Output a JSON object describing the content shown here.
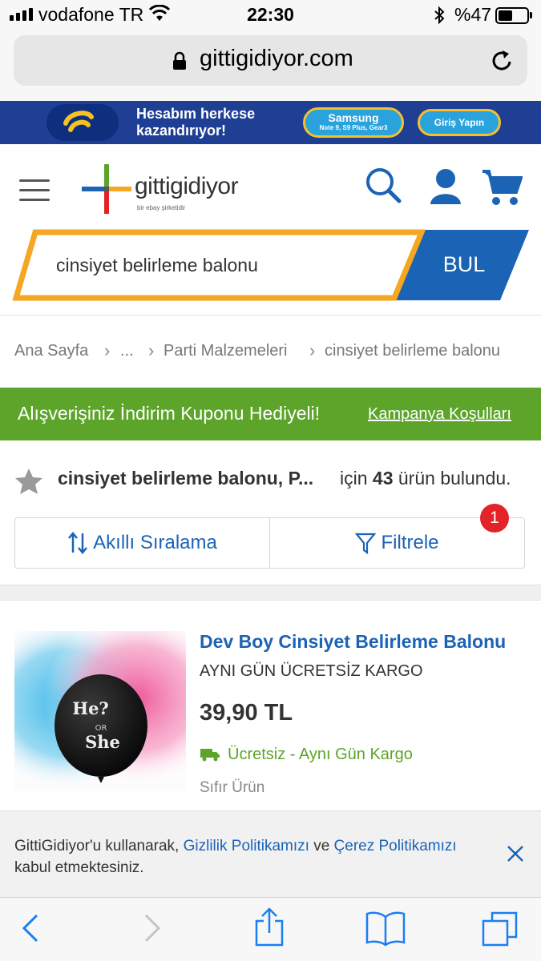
{
  "status_bar": {
    "carrier": "vodafone TR",
    "time": "22:30",
    "battery": "%47",
    "battery_level": 0.47
  },
  "browser": {
    "url": "gittigidiyor.com"
  },
  "banner": {
    "line1": "Hesabım herkese",
    "line2": "kazandırıyor!",
    "samsung_label": "Samsung",
    "samsung_models": "Note 9, S9 Plus, Gear3",
    "login_label": "Giriş Yapın"
  },
  "header": {
    "brand": "gittigidiyor",
    "brand_sub": "bir ebay şirketidir"
  },
  "search": {
    "value": "cinsiyet belirleme balonu",
    "button_label": "BUL"
  },
  "breadcrumb": {
    "items": [
      "Ana Sayfa",
      "...",
      "Parti Malzemeleri",
      "cinsiyet belirleme balonu"
    ]
  },
  "promo": {
    "text": "Alışverişiniz İndirim Kuponu Hediyeli!",
    "link": "Kampanya Koşulları"
  },
  "results": {
    "query": "cinsiyet belirleme balonu, P...",
    "prefix": "için",
    "count": "43",
    "suffix": "ürün bulundu."
  },
  "controls": {
    "sort_label": "Akıllı Sıralama",
    "filter_label": "Filtrele",
    "filter_badge": "1"
  },
  "product": {
    "title": "Dev Boy Cinsiyet Belirleme Balonu",
    "shipping_note": "AYNI GÜN ÜCRETSİZ KARGO",
    "price": "39,90 TL",
    "cargo": "Ücretsiz - Aynı Gün Kargo",
    "condition": "Sıfır Ürün",
    "balloon_text_top": "He?",
    "balloon_text_mid": "OR",
    "balloon_text_bot": "She"
  },
  "cookie": {
    "prefix": "GittiGidiyor'u kullanarak, ",
    "privacy_link": "Gizlilik Politikamızı",
    "middle": " ve ",
    "cookie_link": "Çerez Politikamızı",
    "suffix": " kabul etmektesiniz."
  },
  "colors": {
    "brand_blue": "#1b63b5",
    "promo_green": "#5da42a",
    "search_orange": "#f5a623",
    "badge_red": "#e32327"
  },
  "icons": [
    "signal-icon",
    "wifi-icon",
    "bluetooth-icon",
    "battery-icon",
    "lock-icon",
    "reload-icon",
    "menu-icon",
    "search-icon",
    "user-icon",
    "cart-icon",
    "star-icon",
    "sort-icon",
    "filter-icon",
    "truck-icon",
    "close-icon",
    "back-icon",
    "forward-icon",
    "share-icon",
    "bookmarks-icon",
    "tabs-icon"
  ]
}
